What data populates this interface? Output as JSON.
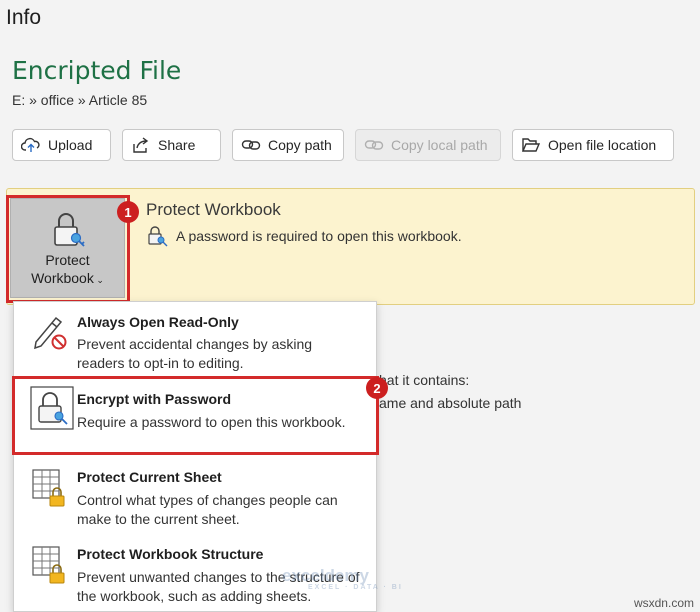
{
  "page": {
    "title": "Info"
  },
  "file": {
    "name": "Encripted File",
    "path": "E: » office » Article 85"
  },
  "toolbar": {
    "upload": "Upload",
    "share": "Share",
    "copy_path": "Copy path",
    "copy_local_path": "Copy local path",
    "open_location": "Open file location"
  },
  "protect": {
    "button_line1": "Protect",
    "button_line2": "Workbook",
    "heading": "Protect Workbook",
    "description": "A password is required to open this workbook."
  },
  "background_text": {
    "line1": "hat it contains:",
    "line2": "ame and absolute path"
  },
  "menu": {
    "items": [
      {
        "title": "Always Open Read-Only",
        "description": "Prevent accidental changes by asking readers to opt-in to editing."
      },
      {
        "title": "Encrypt with Password",
        "description": "Require a password to open this workbook."
      },
      {
        "title": "Protect Current Sheet",
        "description": "Control what types of changes people can make to the current sheet."
      },
      {
        "title": "Protect Workbook Structure",
        "description": "Prevent unwanted changes to the structure of the workbook, such as adding sheets."
      }
    ]
  },
  "annotations": {
    "badge1": "1",
    "badge2": "2"
  },
  "watermark": {
    "brand": "exceldemy",
    "tagline": "EXCEL · DATA · BI"
  },
  "site": "wsxdn.com",
  "colors": {
    "accent_green": "#1e7145",
    "highlight_red": "#d32a2a",
    "panel_yellow": "#fcf3cf"
  }
}
